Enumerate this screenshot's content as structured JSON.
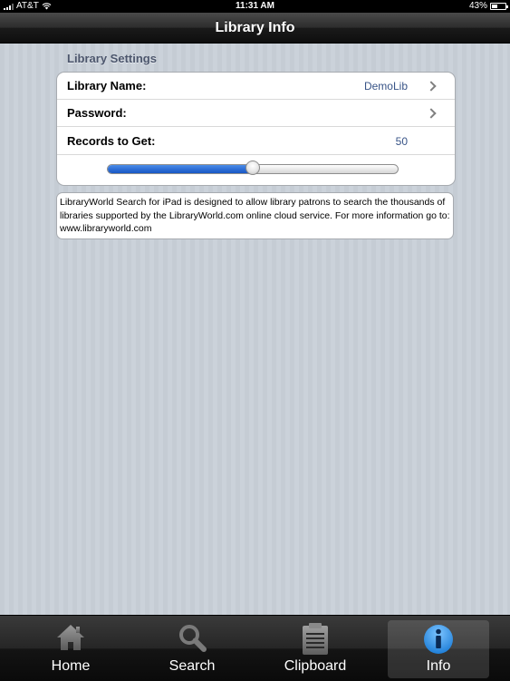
{
  "status_bar": {
    "carrier": "AT&T",
    "time": "11:31 AM",
    "battery_percent": "43%",
    "battery_level": 0.43
  },
  "nav": {
    "title": "Library Info"
  },
  "settings": {
    "header": "Library Settings",
    "library_name_label": "Library Name:",
    "library_name_value": "DemoLib",
    "password_label": "Password:",
    "password_value": "",
    "records_label": "Records to Get:",
    "records_value": "50",
    "slider_level": 0.5
  },
  "info_text": "LibraryWorld Search for iPad is designed to allow library patrons to search the thousands of libraries supported by the LibraryWorld.com online cloud service.  For more information go to: www.libraryworld.com",
  "tabs": {
    "home": "Home",
    "search": "Search",
    "clipboard": "Clipboard",
    "info": "Info",
    "selected": "info"
  },
  "colors": {
    "accent": "#1958c4",
    "value_text": "#385487",
    "section_header": "#4c566c"
  },
  "icons": {
    "home": "home-icon",
    "search": "magnifier-icon",
    "clipboard": "clipboard-icon",
    "info": "info-icon"
  }
}
